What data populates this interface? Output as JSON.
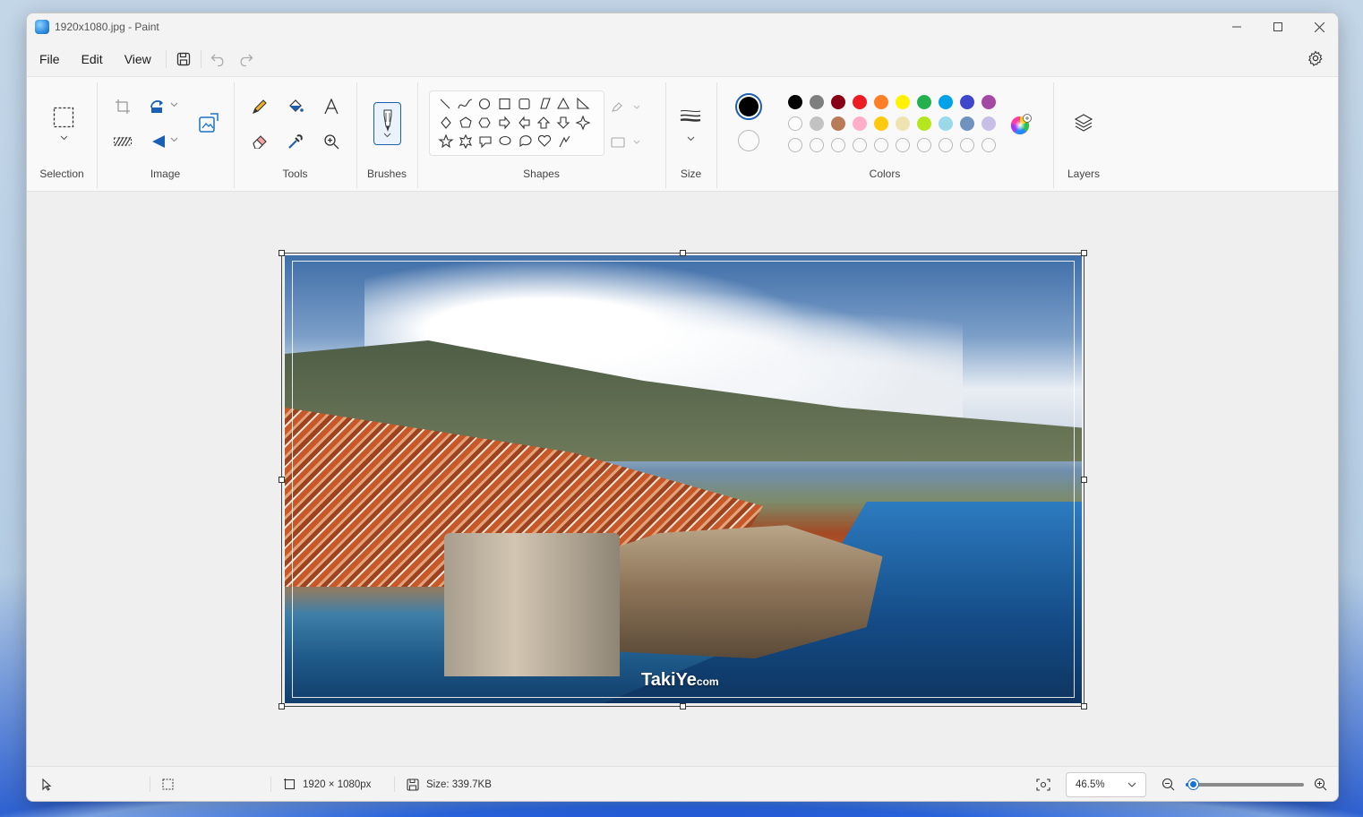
{
  "window": {
    "title": "1920x1080.jpg - Paint",
    "minimize_icon": "minimize-icon",
    "maximize_icon": "maximize-icon",
    "close_icon": "close-icon"
  },
  "menubar": {
    "file": "File",
    "edit": "Edit",
    "view": "View"
  },
  "ribbon": {
    "selection": "Selection",
    "image": "Image",
    "tools": "Tools",
    "brushes": "Brushes",
    "shapes": "Shapes",
    "size": "Size",
    "colors": "Colors",
    "layers": "Layers"
  },
  "palette": {
    "primary": "#000000",
    "secondary": "#ffffff",
    "row1": [
      "#000000",
      "#7f7f7f",
      "#880015",
      "#ed1c24",
      "#ff7f27",
      "#fff200",
      "#22b14c",
      "#00a2e8",
      "#3f48cc",
      "#a349a4"
    ],
    "row2": [
      "#ffffff",
      "#c3c3c3",
      "#b97a57",
      "#ffaec9",
      "#ffc90e",
      "#efe4b0",
      "#b5e61d",
      "#99d9ea",
      "#7092be",
      "#c8bfe7"
    ],
    "row3_empty_count": 10
  },
  "canvas": {
    "watermark_brand": "TakiYe",
    "watermark_suffix": "com"
  },
  "status": {
    "dimensions": "1920 × 1080px",
    "size": "Size: 339.7KB",
    "zoom": "46.5%",
    "zoom_fraction": 0.07
  }
}
